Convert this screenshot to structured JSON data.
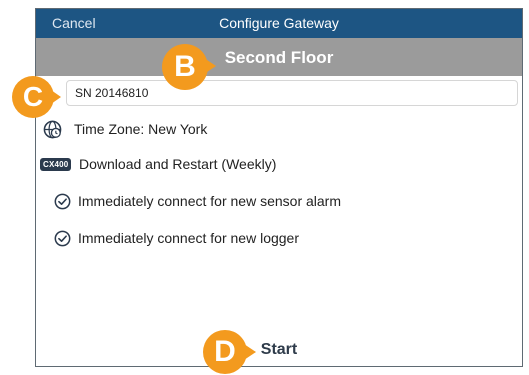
{
  "navbar": {
    "cancel_label": "Cancel",
    "title": "Configure Gateway"
  },
  "subheader": {
    "title": "Second Floor"
  },
  "serial_field": {
    "value": "SN 20146810"
  },
  "settings": {
    "time_zone": "Time Zone: New York",
    "cx_badge": "CX400",
    "download_restart": "Download and Restart (Weekly)",
    "sensor_alarm": "Immediately connect for new sensor alarm",
    "new_logger": "Immediately connect for new logger"
  },
  "footer": {
    "start_label": "Start"
  },
  "callouts": {
    "b": "B",
    "c": "C",
    "d": "D"
  },
  "colors": {
    "navbar": "#1d5583",
    "subheader": "#9b9b9b",
    "callout": "#f39a1e"
  },
  "icons": {
    "time_zone": "globe-clock-icon",
    "check": "check-circle-icon",
    "badge": "cx400-badge-icon"
  }
}
